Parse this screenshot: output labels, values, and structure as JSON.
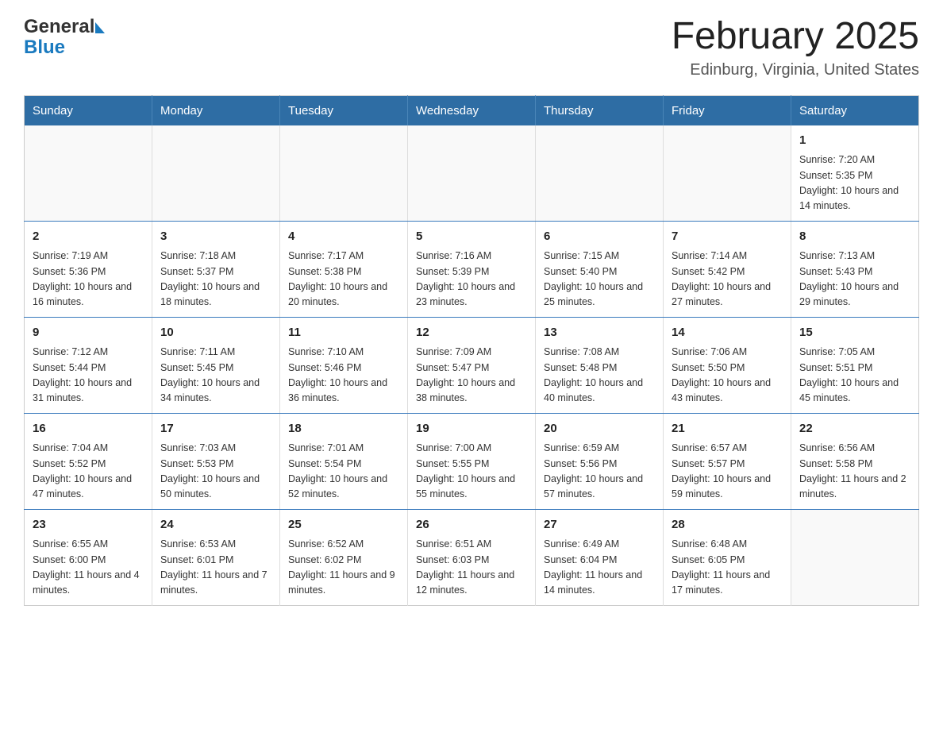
{
  "header": {
    "logo_general": "General",
    "logo_blue": "Blue",
    "month_title": "February 2025",
    "location": "Edinburg, Virginia, United States"
  },
  "days_of_week": [
    "Sunday",
    "Monday",
    "Tuesday",
    "Wednesday",
    "Thursday",
    "Friday",
    "Saturday"
  ],
  "weeks": [
    {
      "days": [
        {
          "number": "",
          "info": "",
          "empty": true
        },
        {
          "number": "",
          "info": "",
          "empty": true
        },
        {
          "number": "",
          "info": "",
          "empty": true
        },
        {
          "number": "",
          "info": "",
          "empty": true
        },
        {
          "number": "",
          "info": "",
          "empty": true
        },
        {
          "number": "",
          "info": "",
          "empty": true
        },
        {
          "number": "1",
          "info": "Sunrise: 7:20 AM\nSunset: 5:35 PM\nDaylight: 10 hours and 14 minutes.",
          "empty": false
        }
      ]
    },
    {
      "days": [
        {
          "number": "2",
          "info": "Sunrise: 7:19 AM\nSunset: 5:36 PM\nDaylight: 10 hours and 16 minutes.",
          "empty": false
        },
        {
          "number": "3",
          "info": "Sunrise: 7:18 AM\nSunset: 5:37 PM\nDaylight: 10 hours and 18 minutes.",
          "empty": false
        },
        {
          "number": "4",
          "info": "Sunrise: 7:17 AM\nSunset: 5:38 PM\nDaylight: 10 hours and 20 minutes.",
          "empty": false
        },
        {
          "number": "5",
          "info": "Sunrise: 7:16 AM\nSunset: 5:39 PM\nDaylight: 10 hours and 23 minutes.",
          "empty": false
        },
        {
          "number": "6",
          "info": "Sunrise: 7:15 AM\nSunset: 5:40 PM\nDaylight: 10 hours and 25 minutes.",
          "empty": false
        },
        {
          "number": "7",
          "info": "Sunrise: 7:14 AM\nSunset: 5:42 PM\nDaylight: 10 hours and 27 minutes.",
          "empty": false
        },
        {
          "number": "8",
          "info": "Sunrise: 7:13 AM\nSunset: 5:43 PM\nDaylight: 10 hours and 29 minutes.",
          "empty": false
        }
      ]
    },
    {
      "days": [
        {
          "number": "9",
          "info": "Sunrise: 7:12 AM\nSunset: 5:44 PM\nDaylight: 10 hours and 31 minutes.",
          "empty": false
        },
        {
          "number": "10",
          "info": "Sunrise: 7:11 AM\nSunset: 5:45 PM\nDaylight: 10 hours and 34 minutes.",
          "empty": false
        },
        {
          "number": "11",
          "info": "Sunrise: 7:10 AM\nSunset: 5:46 PM\nDaylight: 10 hours and 36 minutes.",
          "empty": false
        },
        {
          "number": "12",
          "info": "Sunrise: 7:09 AM\nSunset: 5:47 PM\nDaylight: 10 hours and 38 minutes.",
          "empty": false
        },
        {
          "number": "13",
          "info": "Sunrise: 7:08 AM\nSunset: 5:48 PM\nDaylight: 10 hours and 40 minutes.",
          "empty": false
        },
        {
          "number": "14",
          "info": "Sunrise: 7:06 AM\nSunset: 5:50 PM\nDaylight: 10 hours and 43 minutes.",
          "empty": false
        },
        {
          "number": "15",
          "info": "Sunrise: 7:05 AM\nSunset: 5:51 PM\nDaylight: 10 hours and 45 minutes.",
          "empty": false
        }
      ]
    },
    {
      "days": [
        {
          "number": "16",
          "info": "Sunrise: 7:04 AM\nSunset: 5:52 PM\nDaylight: 10 hours and 47 minutes.",
          "empty": false
        },
        {
          "number": "17",
          "info": "Sunrise: 7:03 AM\nSunset: 5:53 PM\nDaylight: 10 hours and 50 minutes.",
          "empty": false
        },
        {
          "number": "18",
          "info": "Sunrise: 7:01 AM\nSunset: 5:54 PM\nDaylight: 10 hours and 52 minutes.",
          "empty": false
        },
        {
          "number": "19",
          "info": "Sunrise: 7:00 AM\nSunset: 5:55 PM\nDaylight: 10 hours and 55 minutes.",
          "empty": false
        },
        {
          "number": "20",
          "info": "Sunrise: 6:59 AM\nSunset: 5:56 PM\nDaylight: 10 hours and 57 minutes.",
          "empty": false
        },
        {
          "number": "21",
          "info": "Sunrise: 6:57 AM\nSunset: 5:57 PM\nDaylight: 10 hours and 59 minutes.",
          "empty": false
        },
        {
          "number": "22",
          "info": "Sunrise: 6:56 AM\nSunset: 5:58 PM\nDaylight: 11 hours and 2 minutes.",
          "empty": false
        }
      ]
    },
    {
      "days": [
        {
          "number": "23",
          "info": "Sunrise: 6:55 AM\nSunset: 6:00 PM\nDaylight: 11 hours and 4 minutes.",
          "empty": false
        },
        {
          "number": "24",
          "info": "Sunrise: 6:53 AM\nSunset: 6:01 PM\nDaylight: 11 hours and 7 minutes.",
          "empty": false
        },
        {
          "number": "25",
          "info": "Sunrise: 6:52 AM\nSunset: 6:02 PM\nDaylight: 11 hours and 9 minutes.",
          "empty": false
        },
        {
          "number": "26",
          "info": "Sunrise: 6:51 AM\nSunset: 6:03 PM\nDaylight: 11 hours and 12 minutes.",
          "empty": false
        },
        {
          "number": "27",
          "info": "Sunrise: 6:49 AM\nSunset: 6:04 PM\nDaylight: 11 hours and 14 minutes.",
          "empty": false
        },
        {
          "number": "28",
          "info": "Sunrise: 6:48 AM\nSunset: 6:05 PM\nDaylight: 11 hours and 17 minutes.",
          "empty": false
        },
        {
          "number": "",
          "info": "",
          "empty": true
        }
      ]
    }
  ]
}
